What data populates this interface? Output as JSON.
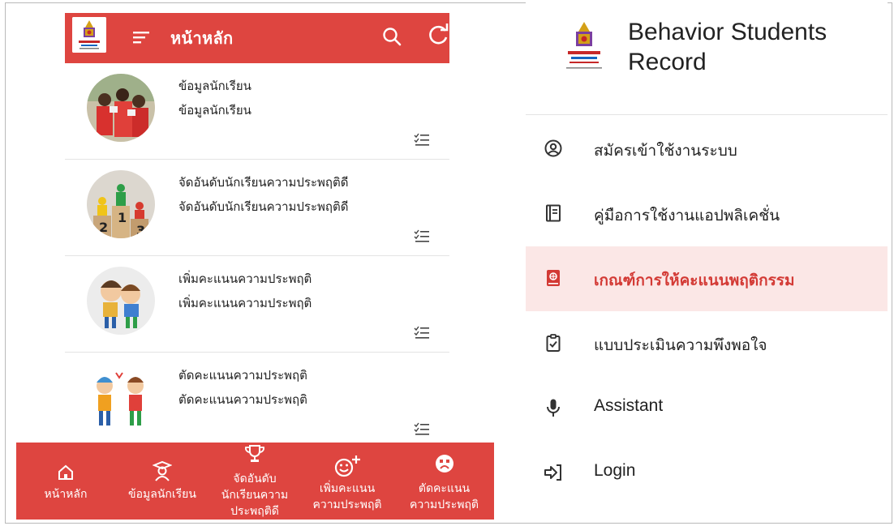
{
  "colors": {
    "primary": "#de4540",
    "active_bg": "#fbe7e6",
    "active_text": "#d33a35"
  },
  "left_app": {
    "header": {
      "title": "หน้าหลัก",
      "logo": "school-logo",
      "icons": [
        "menu-icon",
        "search-icon",
        "refresh-icon"
      ]
    },
    "list": [
      {
        "title": "ข้อมูลนักเรียน",
        "subtitle": "ข้อมูลนักเรียน",
        "image": "students-photo",
        "action_icon": "checklist-icon"
      },
      {
        "title": "จัดอันดับนักเรียนความประพฤติดี",
        "subtitle": "จัดอันดับนักเรียนความประพฤติดี",
        "image": "podium-ranking",
        "action_icon": "checklist-icon"
      },
      {
        "title": "เพิ่มคะแนนความประพฤติ",
        "subtitle": "เพิ่มคะแนนความประพฤติ",
        "image": "happy-kids-cartoon",
        "action_icon": "checklist-icon"
      },
      {
        "title": "ตัดคะแนนความประพฤติ",
        "subtitle": "ตัดคะแนนความประพฤติ",
        "image": "quarrel-kids-cartoon",
        "action_icon": "checklist-icon"
      }
    ],
    "bottom_nav": [
      {
        "line1": "หน้าหลัก",
        "line2": "",
        "line3": "",
        "icon": "home-icon"
      },
      {
        "line1": "ข้อมูลนักเรียน",
        "line2": "",
        "line3": "",
        "icon": "graduate-icon"
      },
      {
        "line1": "จัดอันดับ",
        "line2": "นักเรียนความ",
        "line3": "ประพฤติดี",
        "icon": "trophy-icon"
      },
      {
        "line1": "เพิ่มคะแนน",
        "line2": "ความประพฤติ",
        "line3": "",
        "icon": "smile-plus-icon"
      },
      {
        "line1": "ตัดคะแนน",
        "line2": "ความประพฤติ",
        "line3": "",
        "icon": "sad-face-icon"
      }
    ]
  },
  "right_drawer": {
    "brand": {
      "line1": "Behavior Students",
      "line2": "Record",
      "logo": "school-logo"
    },
    "items": [
      {
        "label": "สมัครเข้าใช้งานระบบ",
        "icon": "account-circle-icon",
        "active": false
      },
      {
        "label": "คู่มือการใช้งานแอปพลิเคชั่น",
        "icon": "manual-icon",
        "active": false
      },
      {
        "label": "เกณฑ์การให้คะแนนพฤติกรรม",
        "icon": "book-icon",
        "active": true
      },
      {
        "label": "แบบประเมินความพึงพอใจ",
        "icon": "clipboard-check-icon",
        "active": false
      },
      {
        "label": "Assistant",
        "icon": "microphone-icon",
        "active": false
      },
      {
        "label": "Login",
        "icon": "login-icon",
        "active": false
      }
    ]
  }
}
